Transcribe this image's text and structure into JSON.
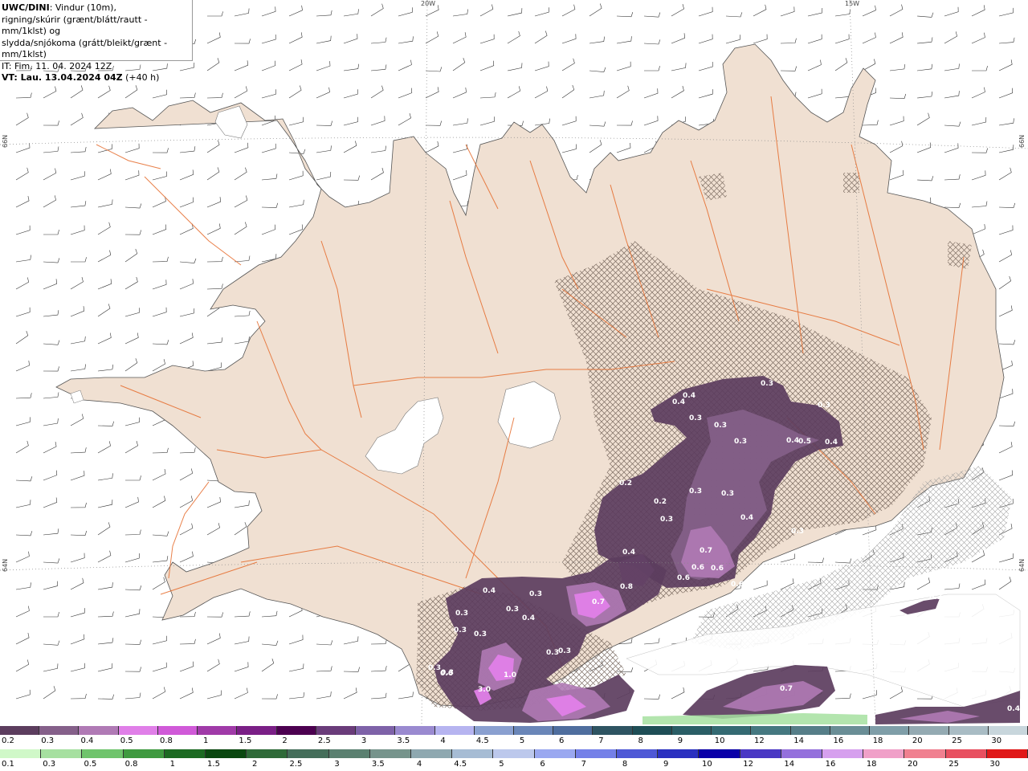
{
  "header": {
    "model": "UWC/DINI",
    "title_line1": ": Vindur (10m),",
    "title_line2": "rigning/skúrir (grænt/blátt/rautt - mm/1klst) og",
    "title_line3": "slydda/snjókoma (grátt/bleikt/grænt - mm/1klst)",
    "init_time": "IT: Fim. 11. 04. 2024 12Z",
    "valid_prefix": "VT: Lau. 13.04.2024 04Z",
    "valid_suffix": " (+40 h)"
  },
  "graticule": {
    "lon_labels": [
      "20W",
      "15W"
    ],
    "lat_labels": [
      "66N",
      "65N",
      "64N"
    ]
  },
  "precip_labels": [
    "0.3",
    "0.4",
    "0.4",
    "0.3",
    "0.3",
    "0.3",
    "0.4",
    "0.5",
    "0.4",
    "0.3",
    "0.2",
    "0.2",
    "0.3",
    "0.3",
    "0.3",
    "0.4",
    "0.3",
    "0.4",
    "0.7",
    "0.6",
    "0.6",
    "0.6",
    "0.8",
    "0.6",
    "0.7",
    "0.4",
    "0.3",
    "0.3",
    "0.4",
    "0.3",
    "0.3",
    "0.3",
    "0.3",
    "0.3",
    "0.3",
    "1.0",
    "3.0",
    "0.3",
    "0.6",
    "0.7",
    "0.4",
    "0.2"
  ],
  "legend_snow": {
    "labels": [
      "0.2",
      "0.3",
      "0.4",
      "0.5",
      "0.8",
      "1",
      "1.5",
      "2",
      "2.5",
      "3",
      "3.5",
      "4",
      "4.5",
      "5",
      "6",
      "7",
      "8",
      "9",
      "10",
      "12",
      "14",
      "16",
      "18",
      "20",
      "25",
      "30"
    ],
    "colors": [
      "#5c3d5e",
      "#85608a",
      "#b07ab5",
      "#e07fe8",
      "#d05ad8",
      "#a03aa8",
      "#7a1f86",
      "#4c0050",
      "#6a3c7a",
      "#7e62a8",
      "#9a8ad0",
      "#b6b4f0",
      "#8aa0d0",
      "#6a86b8",
      "#4f6e9e",
      "#2e5462",
      "#1e4e56",
      "#2a5e66",
      "#346a72",
      "#457880",
      "#567e88",
      "#6a8e96",
      "#7f9ea8",
      "#94aab2",
      "#a9bcc4",
      "#c8d6dc"
    ]
  },
  "legend_rain": {
    "labels": [
      "0.1",
      "0.3",
      "0.5",
      "0.8",
      "1",
      "1.5",
      "2",
      "2.5",
      "3",
      "3.5",
      "4",
      "4.5",
      "5",
      "6",
      "7",
      "8",
      "9",
      "10",
      "12",
      "14",
      "16",
      "18",
      "20",
      "25",
      "30"
    ],
    "colors": [
      "#d0f8c8",
      "#a6e0a0",
      "#6fc46c",
      "#3f9a40",
      "#1c6a22",
      "#0a4810",
      "#2e6a38",
      "#446e5a",
      "#5a8070",
      "#76948c",
      "#8ea8b0",
      "#a6bcd4",
      "#bcc8ec",
      "#9aa8f0",
      "#7480e8",
      "#4e58d6",
      "#2a30c0",
      "#0a00a8",
      "#4a38c4",
      "#9470dc",
      "#d6a0ee",
      "#f0a0c8",
      "#f08090",
      "#e85060",
      "#e01818"
    ]
  }
}
